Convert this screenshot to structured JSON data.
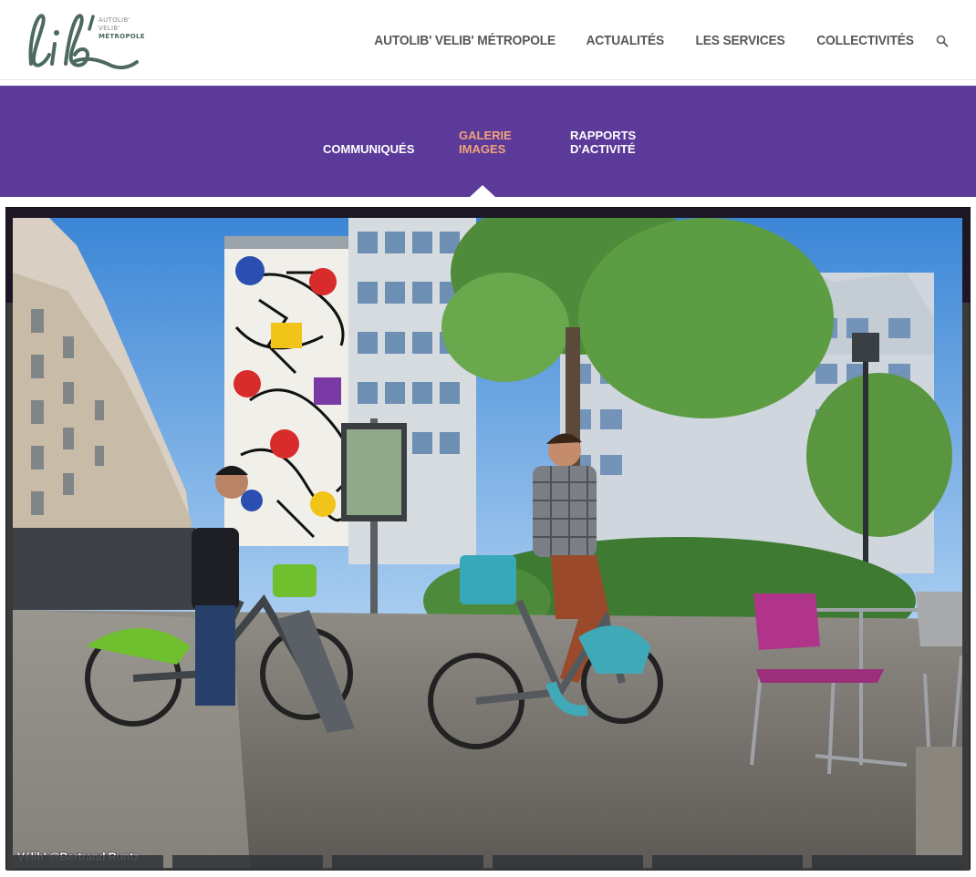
{
  "header": {
    "logo": {
      "wordmark": "lib'",
      "line1": "AUTOLIB'",
      "line2": "VELIB'",
      "line3": "MÉTROPOLE",
      "color": "#4d6a62"
    },
    "nav": [
      {
        "label": "AUTOLIB' VELIB' MÉTROPOLE"
      },
      {
        "label": "ACTUALITÉS"
      },
      {
        "label": "LES SERVICES"
      },
      {
        "label": "COLLECTIVITÉS"
      }
    ],
    "search_icon": "search-icon"
  },
  "subnav": {
    "background": "#5b3a9a",
    "active_color": "#f2a37a",
    "items": [
      {
        "label": "COMMUNIQUÉS"
      },
      {
        "line1": "GALERIE",
        "line2": "IMAGES",
        "active": true
      },
      {
        "line1": "RAPPORTS",
        "line2": "D'ACTIVITÉ"
      }
    ]
  },
  "gallery": {
    "caption": "Vélib' @Bertrand Runtz"
  }
}
